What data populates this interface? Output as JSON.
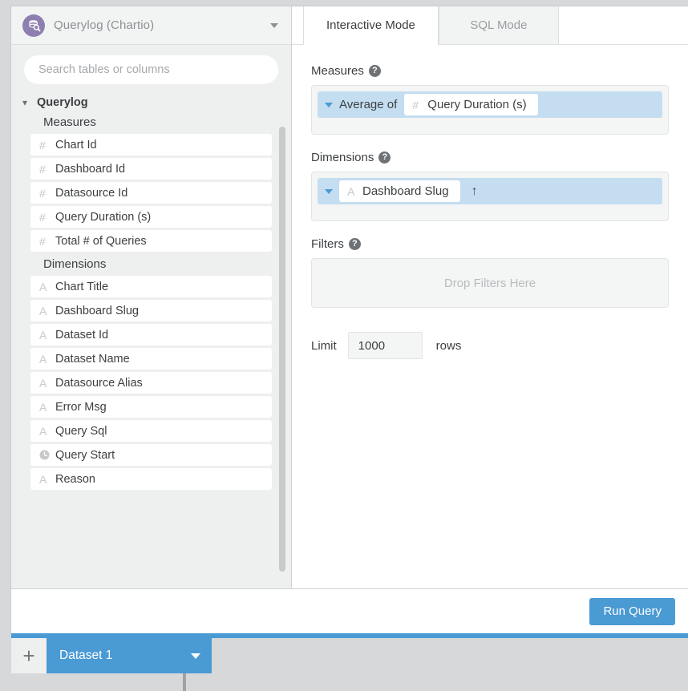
{
  "datasource": {
    "name": "Querylog (Chartio)",
    "icon": "database-search-icon",
    "caret": "chevron-down-icon"
  },
  "search": {
    "placeholder": "Search tables or columns",
    "value": ""
  },
  "tree": {
    "root_label": "Querylog",
    "chevron": "⌄",
    "groups": [
      {
        "label": "Measures",
        "fields": [
          {
            "icon": "#",
            "icon_name": "number-icon",
            "label": "Chart Id"
          },
          {
            "icon": "#",
            "icon_name": "number-icon",
            "label": "Dashboard Id"
          },
          {
            "icon": "#",
            "icon_name": "number-icon",
            "label": "Datasource Id"
          },
          {
            "icon": "#",
            "icon_name": "number-icon",
            "label": "Query Duration (s)"
          },
          {
            "icon": "#",
            "icon_name": "number-icon",
            "label": "Total # of Queries"
          }
        ]
      },
      {
        "label": "Dimensions",
        "fields": [
          {
            "icon": "A",
            "icon_name": "text-icon",
            "label": "Chart Title"
          },
          {
            "icon": "A",
            "icon_name": "text-icon",
            "label": "Dashboard Slug"
          },
          {
            "icon": "A",
            "icon_name": "text-icon",
            "label": "Dataset Id"
          },
          {
            "icon": "A",
            "icon_name": "text-icon",
            "label": "Dataset Name"
          },
          {
            "icon": "A",
            "icon_name": "text-icon",
            "label": "Datasource Alias"
          },
          {
            "icon": "A",
            "icon_name": "text-icon",
            "label": "Error Msg"
          },
          {
            "icon": "A",
            "icon_name": "text-icon",
            "label": "Query Sql"
          },
          {
            "icon": "◔",
            "icon_name": "clock-icon",
            "label": "Query Start"
          },
          {
            "icon": "A",
            "icon_name": "text-icon",
            "label": "Reason"
          }
        ]
      }
    ]
  },
  "tabs": [
    {
      "label": "Interactive Mode",
      "active": true
    },
    {
      "label": "SQL Mode",
      "active": false
    }
  ],
  "measures": {
    "title": "Measures",
    "help": "?",
    "pill": {
      "aggregation": "Average of",
      "field_icon": "#",
      "field_label": "Query Duration (s)"
    }
  },
  "dimensions": {
    "title": "Dimensions",
    "help": "?",
    "pill": {
      "field_icon": "A",
      "field_label": "Dashboard Slug",
      "sort": "↑"
    }
  },
  "filters": {
    "title": "Filters",
    "help": "?",
    "empty_text": "Drop Filters Here"
  },
  "limit": {
    "label": "Limit",
    "value": "1000",
    "unit": "rows"
  },
  "footer": {
    "run_label": "Run Query"
  },
  "datasets": {
    "add_label": "+",
    "tab_label": "Dataset 1",
    "tab_caret": "chevron-down-icon"
  },
  "colors": {
    "accent_blue": "#4a9ad4",
    "pill_blue": "#c4ddf0",
    "purple": "#8d7fb0",
    "page_bg": "#d6d8da",
    "sidebar_bg": "#eeefef"
  }
}
